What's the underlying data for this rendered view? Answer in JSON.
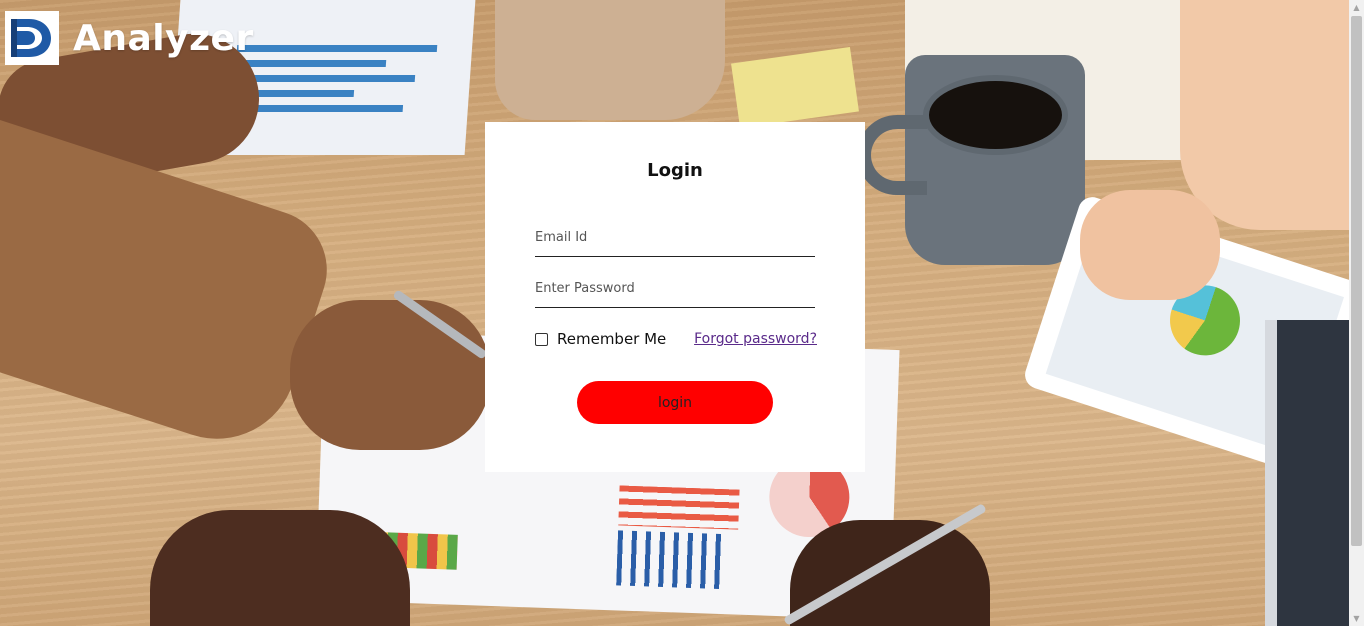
{
  "brand": {
    "name": "Analyzer",
    "logo_icon": "d-logo-icon"
  },
  "login": {
    "title": "Login",
    "email_placeholder": "Email Id",
    "email_value": "",
    "password_placeholder": "Enter Password",
    "password_value": "",
    "remember_label": "Remember Me",
    "remember_checked": false,
    "forgot_link": "Forgot password?",
    "submit_label": "login"
  },
  "colors": {
    "accent": "#ff0000",
    "card_bg": "#ffffff",
    "link": "#5a2a8a",
    "logo_blue": "#1f5aa6"
  }
}
